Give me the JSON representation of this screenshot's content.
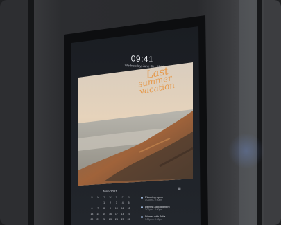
{
  "screen": {
    "time": "09:41",
    "date": "Wednesday, June 30 · 22.3°",
    "photo_caption_line1": "Last",
    "photo_caption_line2": "summer vacation"
  },
  "calendar": {
    "month": "June 2021",
    "icon": "calendar-icon",
    "weekdays": [
      "S",
      "M",
      "T",
      "W",
      "T",
      "F",
      "S"
    ],
    "days": [
      "",
      "",
      "1",
      "2",
      "3",
      "4",
      "5",
      "6",
      "7",
      "8",
      "9",
      "10",
      "11",
      "12",
      "13",
      "14",
      "15",
      "16",
      "17",
      "18",
      "19",
      "20",
      "21",
      "22",
      "23",
      "24",
      "25",
      "26"
    ]
  },
  "events": [
    {
      "title": "Planning open",
      "sub": "1:00pm – 2:00pm"
    },
    {
      "title": "Dentist appointment",
      "sub": "3:00pm – 4:00pm"
    },
    {
      "title": "Dinner with Julia",
      "sub": "7:00pm – 9:00pm"
    }
  ],
  "colors": {
    "caption": "#e59a4e",
    "panel": "#1c2026",
    "frame": "#0e0f11"
  }
}
